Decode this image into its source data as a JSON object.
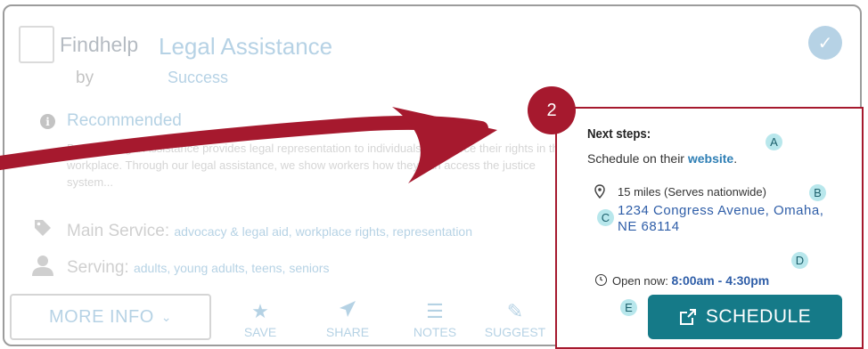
{
  "card": {
    "provider_name": "Findhelp",
    "provider_by": "by",
    "program_name": "Legal Assistance",
    "program_sub": "Success",
    "recommended": "Recommended",
    "description": "Bertha's Legal Assistance provides legal representation to individuals to enforce their rights in the workplace. Through our legal assistance, we show workers how they can access the justice system...",
    "main_service_label": "Main Service: ",
    "main_service_values": "advocacy & legal aid, workplace rights, representation",
    "serving_label": "Serving: ",
    "serving_values": "adults, young adults, teens, seniors",
    "more_info": "MORE INFO",
    "actions": [
      {
        "label": "SAVE",
        "icon": "star-icon"
      },
      {
        "label": "SHARE",
        "icon": "send-icon"
      },
      {
        "label": "NOTES",
        "icon": "list-icon"
      },
      {
        "label": "SUGGEST",
        "icon": "pencil-icon"
      }
    ]
  },
  "panel": {
    "title": "Next steps:",
    "schedule_text": "Schedule on their ",
    "website_link": "website",
    "schedule_text_end": ".",
    "distance": "15 miles (Serves nationwide)",
    "address_line1": "1234 Congress Avenue, Omaha,",
    "address_line2": "NE 68114",
    "open_label": "Open now: ",
    "hours": "8:00am - 4:30pm",
    "schedule_button": "SCHEDULE"
  },
  "annotations": {
    "step_number": "2",
    "letters": [
      "A",
      "B",
      "C",
      "D",
      "E"
    ]
  },
  "colors": {
    "accent_red": "#a6192e",
    "link_blue": "#2f7fb5",
    "teal_button": "#157a88",
    "badge_bg": "#b8e7ec"
  }
}
